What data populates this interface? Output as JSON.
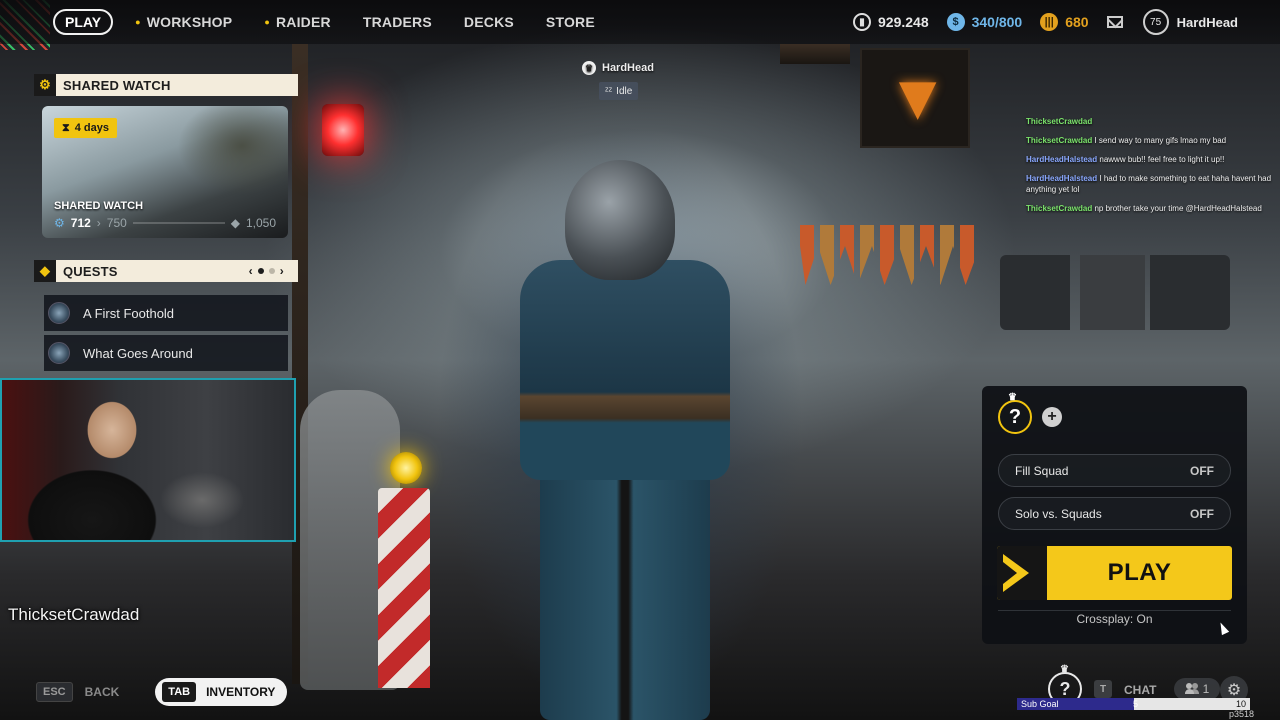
{
  "nav": {
    "play": "PLAY",
    "items": [
      {
        "label": "WORKSHOP",
        "dot": true
      },
      {
        "label": "RAIDER",
        "dot": true
      },
      {
        "label": "TRADERS",
        "dot": false
      },
      {
        "label": "DECKS",
        "dot": false
      },
      {
        "label": "STORE",
        "dot": false
      }
    ],
    "currencies": {
      "coins": "929.248",
      "credits": "340/800",
      "raider_tokens": "680"
    },
    "level": "75",
    "username": "HardHead"
  },
  "shared_watch": {
    "header": "SHARED WATCH",
    "days_left": "4 days",
    "card_title": "SHARED WATCH",
    "current": "712",
    "next": "750",
    "max": "1,050"
  },
  "quests": {
    "header": "QUESTS",
    "page_current": 1,
    "page_total": 2,
    "items": [
      {
        "title": "A First Foothold"
      },
      {
        "title": "What Goes Around"
      }
    ]
  },
  "player_tag": {
    "name": "HardHead",
    "status": "Idle"
  },
  "webcam": {
    "name": "ThicksetCrawdad"
  },
  "stream_chat": [
    {
      "user": "ThicksetCrawdad",
      "user_color": "#7be36b",
      "text": ""
    },
    {
      "user": "ThicksetCrawdad",
      "user_color": "#7be36b",
      "text": "I send way to many gifs lmao my bad"
    },
    {
      "user": "HardHeadHalstead",
      "user_color": "#8aa8ff",
      "text": "nawww bub!! feel free to light it up!!"
    },
    {
      "user": "HardHeadHalstead",
      "user_color": "#8aa8ff",
      "text": "I had to make something to eat haha havent had anything yet lol"
    },
    {
      "user": "ThicksetCrawdad",
      "user_color": "#7be36b",
      "text": "np brother take your time @HardHeadHalstead"
    }
  ],
  "play_panel": {
    "fill_squad_label": "Fill Squad",
    "fill_squad_value": "OFF",
    "solo_label": "Solo vs. Squads",
    "solo_value": "OFF",
    "play_label": "PLAY",
    "crossplay": "Crossplay: On"
  },
  "bottom_bar": {
    "esc_key": "ESC",
    "back_label": "BACK",
    "tab_key": "TAB",
    "inventory_label": "INVENTORY",
    "chat_key": "T",
    "chat_label": "CHAT",
    "friends_count": "1"
  },
  "sub_goal": {
    "label": "Sub Goal",
    "current": "5",
    "max": "10",
    "progress_fraction": 0.5
  },
  "watermark": "p3518",
  "colors": {
    "accent_yellow": "#f4c81a",
    "panel_header": "#f3ecdc",
    "webcam_border": "#1fa0b0"
  }
}
